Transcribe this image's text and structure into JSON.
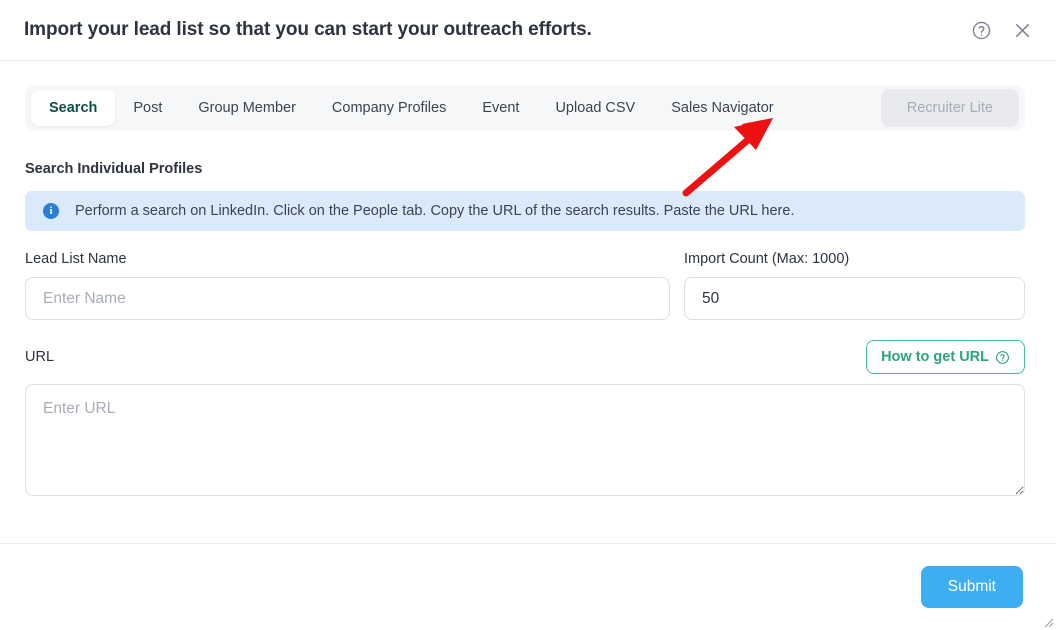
{
  "header": {
    "title": "Import your lead list so that you can start your outreach efforts.",
    "help_icon": "help-circle-icon",
    "close_icon": "close-icon"
  },
  "tabs": [
    {
      "label": "Search",
      "state": "active"
    },
    {
      "label": "Post",
      "state": "default"
    },
    {
      "label": "Group Member",
      "state": "default"
    },
    {
      "label": "Company Profiles",
      "state": "default"
    },
    {
      "label": "Event",
      "state": "default"
    },
    {
      "label": "Upload CSV",
      "state": "default"
    },
    {
      "label": "Sales Navigator",
      "state": "default"
    },
    {
      "label": "Recruiter Lite",
      "state": "disabled"
    }
  ],
  "section": {
    "title": "Search Individual Profiles"
  },
  "info_banner": {
    "icon": "info-icon",
    "text": "Perform a search on LinkedIn. Click on the People tab. Copy the URL of the search results. Paste the URL here."
  },
  "fields": {
    "lead_list_name": {
      "label": "Lead List Name",
      "placeholder": "Enter Name",
      "value": ""
    },
    "import_count": {
      "label": "Import Count (Max: 1000)",
      "placeholder": "",
      "value": "50"
    },
    "url": {
      "label": "URL",
      "placeholder": "Enter URL",
      "value": ""
    }
  },
  "buttons": {
    "how_to_get_url": "How to get URL",
    "submit": "Submit"
  },
  "annotation": {
    "type": "arrow",
    "points_to": "Sales Navigator",
    "color": "#ee1111"
  },
  "colors": {
    "accent_green": "#2ba37c",
    "submit_blue": "#3eaef2",
    "info_blue": "#2b7ed6",
    "banner_bg": "#daeafb",
    "tabbar_bg": "#f6f7f8",
    "active_tab_text": "#0f4f49",
    "arrow_red": "#ee1111"
  }
}
